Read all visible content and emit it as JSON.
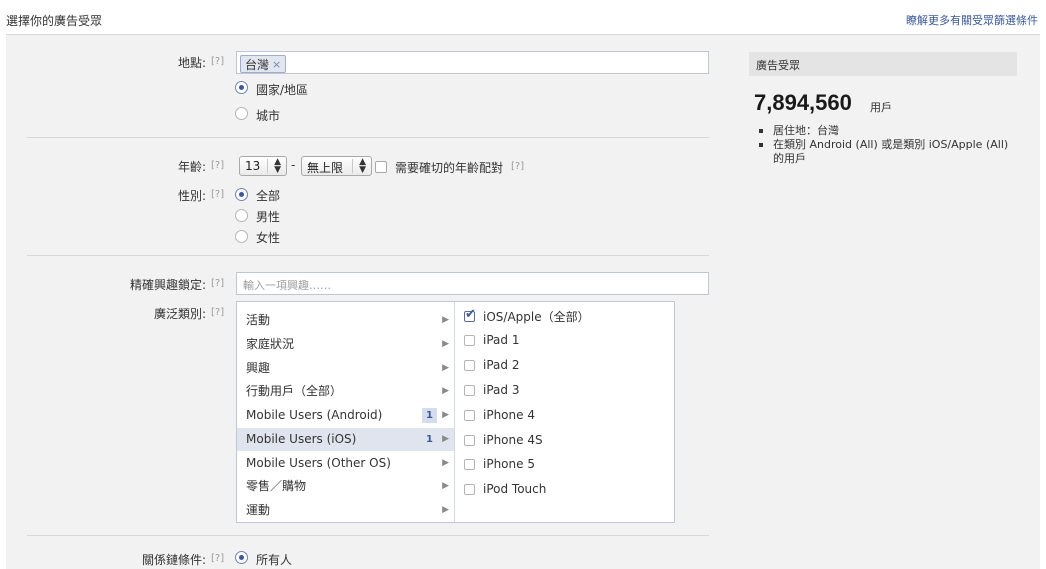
{
  "header": {
    "title": "選擇你的廣告受眾",
    "help_link": "瞭解更多有關受眾篩選條件"
  },
  "help_marker": "[?]",
  "location": {
    "label": "地點:",
    "token": "台灣",
    "token_remove": "×",
    "options": [
      "國家/地區",
      "城市"
    ],
    "selected": "國家/地區"
  },
  "age": {
    "label": "年齡:",
    "min": "13",
    "dash": "-",
    "max": "無上限",
    "exact_label": "需要確切的年齡配對"
  },
  "gender": {
    "label": "性別:",
    "options": [
      "全部",
      "男性",
      "女性"
    ],
    "selected": "全部"
  },
  "precise_interests": {
    "label": "精確興趣鎖定:",
    "placeholder": "輸入一項興趣……"
  },
  "broad_categories": {
    "label": "廣泛類別:",
    "categories": [
      {
        "label": "活動"
      },
      {
        "label": "家庭狀況"
      },
      {
        "label": "興趣"
      },
      {
        "label": "行動用戶（全部）"
      },
      {
        "label": "Mobile Users (Android)",
        "count": "1"
      },
      {
        "label": "Mobile Users (iOS)",
        "count": "1",
        "selected": true
      },
      {
        "label": "Mobile Users (Other OS)"
      },
      {
        "label": "零售／購物"
      },
      {
        "label": "運動"
      }
    ],
    "subcategories": [
      {
        "label": "iOS/Apple（全部）",
        "checked": true
      },
      {
        "label": "iPad 1",
        "checked": false
      },
      {
        "label": "iPad 2",
        "checked": false
      },
      {
        "label": "iPad 3",
        "checked": false
      },
      {
        "label": "iPhone 4",
        "checked": false
      },
      {
        "label": "iPhone 4S",
        "checked": false
      },
      {
        "label": "iPhone 5",
        "checked": false
      },
      {
        "label": "iPod Touch",
        "checked": false
      }
    ]
  },
  "relationship": {
    "label": "關係鏈條件:",
    "selected": "所有人"
  },
  "audience": {
    "heading": "廣告受眾",
    "count": "7,894,560",
    "unit": "用戶",
    "details": [
      "居住地：台灣",
      "在類別 Android (All) 或是類別 iOS/Apple (All) 的用戶"
    ]
  },
  "colors": {
    "accent": "#3b5998",
    "panel_bg": "#f2f2f2",
    "selected_row": "#dfe4ee"
  }
}
